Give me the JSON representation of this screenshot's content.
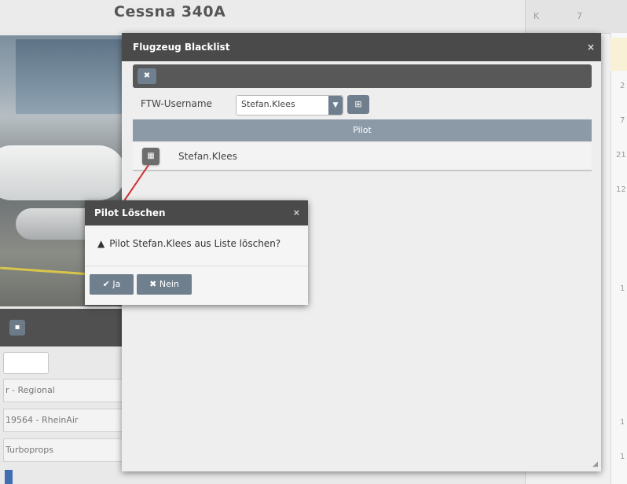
{
  "background": {
    "title": "Cessna 340A",
    "fields": [
      "r - Regional",
      "19564 - RheinAir",
      "Turboprops"
    ],
    "right_header": [
      "K",
      "7"
    ],
    "right_numbers": [
      "2",
      "7",
      "21",
      "12",
      "1",
      "1",
      "1"
    ]
  },
  "dialog": {
    "title": "Flugzeug Blacklist",
    "close_icon": "×",
    "clear_icon": "✖",
    "user_label": "FTW-Username",
    "user_value": "Stefan.Klees",
    "table_header": "Pilot",
    "rows": [
      {
        "name": "Stefan.Klees"
      }
    ]
  },
  "confirm": {
    "title": "Pilot Löschen",
    "close_icon": "×",
    "message": "Pilot Stefan.Klees aus Liste löschen?",
    "yes_label": "Ja",
    "no_label": "Nein"
  },
  "colors": {
    "header": "#4a4a4a",
    "button": "#6f7f8e",
    "arrow": "#d42a2a"
  }
}
